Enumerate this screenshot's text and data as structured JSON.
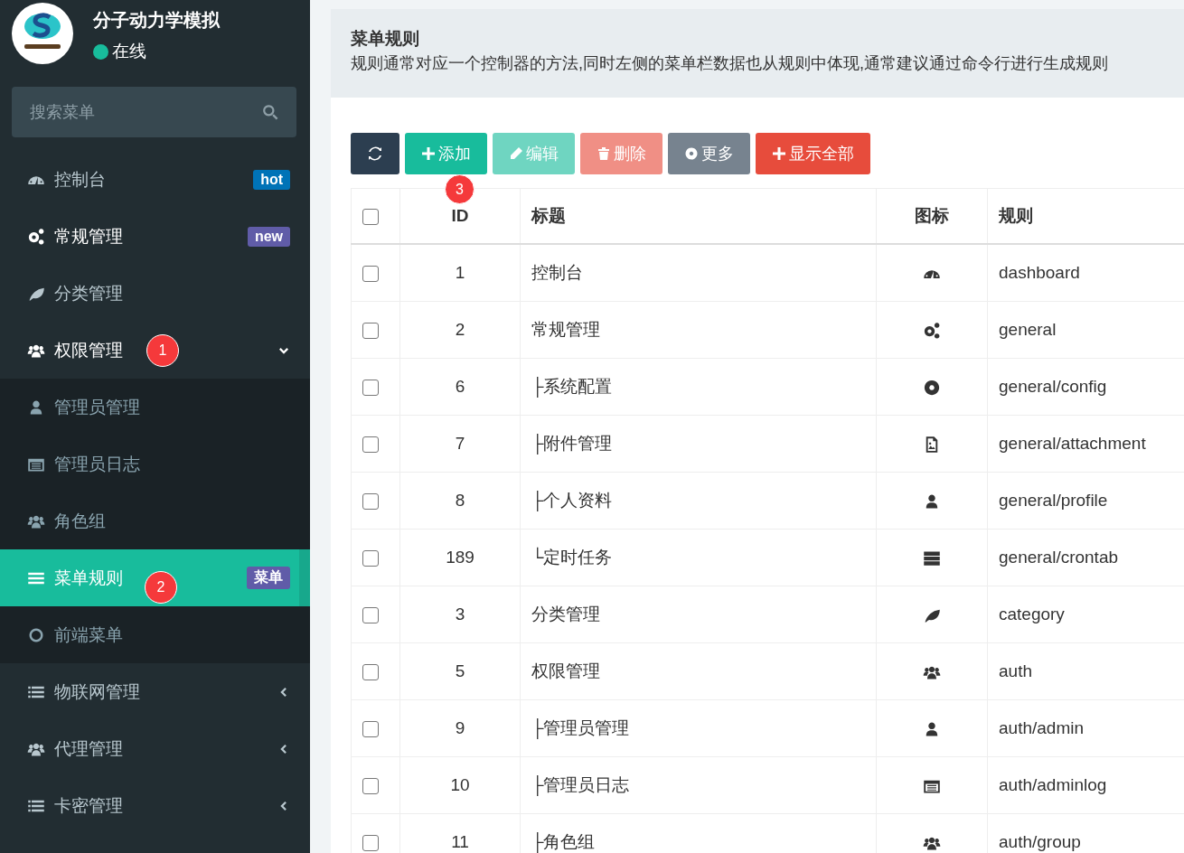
{
  "sidebar": {
    "app_title": "分子动力学模拟",
    "status": {
      "label": "在线",
      "online": true
    },
    "search": {
      "placeholder": "搜索菜单"
    },
    "items": [
      {
        "label": "控制台",
        "selected": false,
        "hovered": false,
        "badge": {
          "text": "hot",
          "color": "#0073b7"
        }
      },
      {
        "label": "常规管理",
        "selected": false,
        "hovered": true,
        "badge": {
          "text": "new",
          "color": "#605ca8"
        }
      },
      {
        "label": "分类管理",
        "selected": false,
        "hovered": false
      },
      {
        "label": "权限管理",
        "selected": false,
        "hovered": false,
        "marker": "1",
        "expanded": true,
        "children": [
          {
            "label": "管理员管理",
            "selected": false
          },
          {
            "label": "管理员日志",
            "selected": false
          },
          {
            "label": "角色组",
            "selected": false
          },
          {
            "label": "菜单规则",
            "selected": true,
            "marker": "2",
            "badge": {
              "text": "菜单",
              "color": "#605ca8"
            }
          },
          {
            "label": "前端菜单",
            "selected": false
          }
        ]
      },
      {
        "label": "物联网管理",
        "selected": false,
        "hovered": false,
        "expanded": false
      },
      {
        "label": "代理管理",
        "selected": false,
        "hovered": false,
        "expanded": false
      },
      {
        "label": "卡密管理",
        "selected": false,
        "hovered": false,
        "expanded": false
      }
    ]
  },
  "page_header": {
    "title": "菜单规则",
    "description": "规则通常对应一个控制器的方法,同时左侧的菜单栏数据也从规则中体现,通常建议通过命令行进行生成规则"
  },
  "toolbar": [
    {
      "kind": "refresh",
      "disabled": false
    },
    {
      "kind": "add",
      "label": "添加",
      "disabled": false,
      "marker": "3"
    },
    {
      "kind": "edit",
      "label": "编辑",
      "disabled": true
    },
    {
      "kind": "delete",
      "label": "删除",
      "disabled": true
    },
    {
      "kind": "more",
      "label": "更多",
      "disabled": false
    },
    {
      "kind": "showall",
      "label": "显示全部",
      "disabled": false
    }
  ],
  "table": {
    "header_checked": false,
    "columns": [
      "ID",
      "标题",
      "图标",
      "规则"
    ],
    "rows": [
      {
        "checked": false,
        "id": "1",
        "title": "控制台",
        "rule": "dashboard"
      },
      {
        "checked": false,
        "id": "2",
        "title": "常规管理",
        "rule": "general"
      },
      {
        "checked": false,
        "id": "6",
        "title": "├系统配置",
        "rule": "general/config"
      },
      {
        "checked": false,
        "id": "7",
        "title": "├附件管理",
        "rule": "general/attachment"
      },
      {
        "checked": false,
        "id": "8",
        "title": "├个人资料",
        "rule": "general/profile"
      },
      {
        "checked": false,
        "id": "189",
        "title": "└定时任务",
        "rule": "general/crontab"
      },
      {
        "checked": false,
        "id": "3",
        "title": "分类管理",
        "rule": "category"
      },
      {
        "checked": false,
        "id": "5",
        "title": "权限管理",
        "rule": "auth"
      },
      {
        "checked": false,
        "id": "9",
        "title": "├管理员管理",
        "rule": "auth/admin"
      },
      {
        "checked": false,
        "id": "10",
        "title": "├管理员日志",
        "rule": "auth/adminlog"
      },
      {
        "checked": false,
        "id": "11",
        "title": "├角色组",
        "rule": "auth/group"
      }
    ]
  }
}
